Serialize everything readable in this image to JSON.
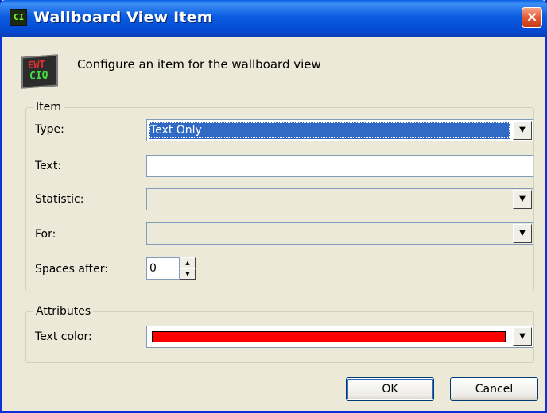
{
  "window": {
    "title": "Wallboard View Item",
    "title_icon_text": "CI",
    "close_glyph": "×"
  },
  "header": {
    "icon_line1": "EWT",
    "icon_line2": "CIQ",
    "subtitle": "Configure an item for the wallboard view"
  },
  "item_group": {
    "legend": "Item",
    "type": {
      "label": "Type:",
      "value": "Text Only"
    },
    "text": {
      "label": "Text:",
      "value": ""
    },
    "statistic": {
      "label": "Statistic:",
      "value": ""
    },
    "for": {
      "label": "For:",
      "value": ""
    },
    "spaces_after": {
      "label": "Spaces after:",
      "value": "0"
    }
  },
  "attributes_group": {
    "legend": "Attributes",
    "text_color": {
      "label": "Text color:",
      "color": "#ff0000"
    }
  },
  "buttons": {
    "ok": "OK",
    "cancel": "Cancel"
  },
  "icons": {
    "dropdown_arrow": "▼",
    "spin_up": "▲",
    "spin_down": "▼"
  }
}
